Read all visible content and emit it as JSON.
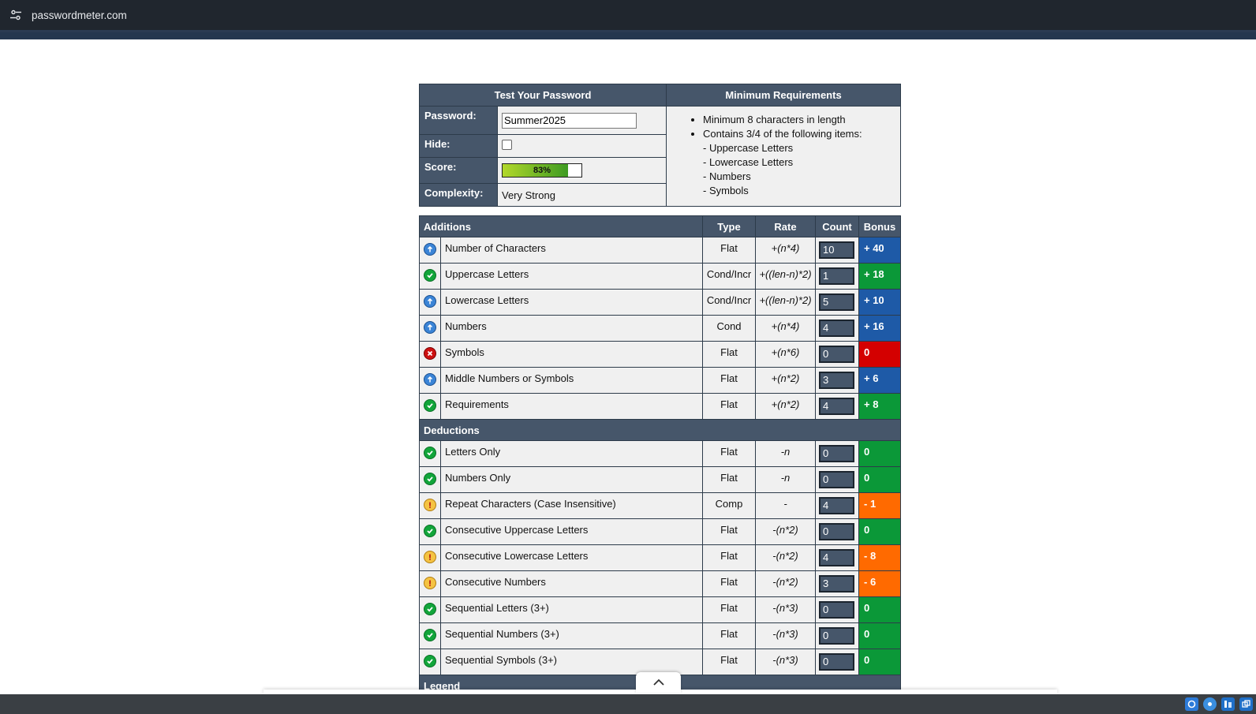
{
  "browser": {
    "url": "passwordmeter.com"
  },
  "test_section": {
    "header": "Test Your Password",
    "password_label": "Password:",
    "password_value": "Summer2025",
    "hide_label": "Hide:",
    "score_label": "Score:",
    "score_text": "83%",
    "score_percent": 83,
    "complexity_label": "Complexity:",
    "complexity_value": "Very Strong"
  },
  "requirements": {
    "header": "Minimum Requirements",
    "items": [
      "Minimum 8 characters in length",
      "Contains 3/4 of the following items:"
    ],
    "sub_items": [
      "- Uppercase Letters",
      "- Lowercase Letters",
      "- Numbers",
      "- Symbols"
    ]
  },
  "score_table": {
    "headers": {
      "additions": "Additions",
      "type": "Type",
      "rate": "Rate",
      "count": "Count",
      "bonus": "Bonus"
    },
    "deductions_label": "Deductions",
    "legend_label": "Legend",
    "additions": [
      {
        "status": "exceptional",
        "desc": "Number of Characters",
        "type": "Flat",
        "rate": "+(n*4)",
        "count": "10",
        "bonus": "+ 40",
        "color": "blue"
      },
      {
        "status": "sufficient",
        "desc": "Uppercase Letters",
        "type": "Cond/Incr",
        "rate": "+((len-n)*2)",
        "count": "1",
        "bonus": "+ 18",
        "color": "green"
      },
      {
        "status": "exceptional",
        "desc": "Lowercase Letters",
        "type": "Cond/Incr",
        "rate": "+((len-n)*2)",
        "count": "5",
        "bonus": "+ 10",
        "color": "blue"
      },
      {
        "status": "exceptional",
        "desc": "Numbers",
        "type": "Cond",
        "rate": "+(n*4)",
        "count": "4",
        "bonus": "+ 16",
        "color": "blue"
      },
      {
        "status": "failure",
        "desc": "Symbols",
        "type": "Flat",
        "rate": "+(n*6)",
        "count": "0",
        "bonus": "0",
        "color": "red"
      },
      {
        "status": "exceptional",
        "desc": "Middle Numbers or Symbols",
        "type": "Flat",
        "rate": "+(n*2)",
        "count": "3",
        "bonus": "+ 6",
        "color": "blue"
      },
      {
        "status": "sufficient",
        "desc": "Requirements",
        "type": "Flat",
        "rate": "+(n*2)",
        "count": "4",
        "bonus": "+ 8",
        "color": "green"
      }
    ],
    "deductions": [
      {
        "status": "sufficient",
        "desc": "Letters Only",
        "type": "Flat",
        "rate": "-n",
        "count": "0",
        "bonus": "0",
        "color": "green"
      },
      {
        "status": "sufficient",
        "desc": "Numbers Only",
        "type": "Flat",
        "rate": "-n",
        "count": "0",
        "bonus": "0",
        "color": "green"
      },
      {
        "status": "warning",
        "desc": "Repeat Characters (Case Insensitive)",
        "type": "Comp",
        "rate": "-",
        "count": "4",
        "bonus": "- 1",
        "color": "orange"
      },
      {
        "status": "sufficient",
        "desc": "Consecutive Uppercase Letters",
        "type": "Flat",
        "rate": "-(n*2)",
        "count": "0",
        "bonus": "0",
        "color": "green"
      },
      {
        "status": "warning",
        "desc": "Consecutive Lowercase Letters",
        "type": "Flat",
        "rate": "-(n*2)",
        "count": "4",
        "bonus": "- 8",
        "color": "orange"
      },
      {
        "status": "warning",
        "desc": "Consecutive Numbers",
        "type": "Flat",
        "rate": "-(n*2)",
        "count": "3",
        "bonus": "- 6",
        "color": "orange"
      },
      {
        "status": "sufficient",
        "desc": "Sequential Letters (3+)",
        "type": "Flat",
        "rate": "-(n*3)",
        "count": "0",
        "bonus": "0",
        "color": "green"
      },
      {
        "status": "sufficient",
        "desc": "Sequential Numbers (3+)",
        "type": "Flat",
        "rate": "-(n*3)",
        "count": "0",
        "bonus": "0",
        "color": "green"
      },
      {
        "status": "sufficient",
        "desc": "Sequential Symbols (3+)",
        "type": "Flat",
        "rate": "-(n*3)",
        "count": "0",
        "bonus": "0",
        "color": "green"
      }
    ]
  },
  "colors": {
    "header_bg": "#46566a",
    "cell_bg": "#f0f0f0",
    "blue": "#1e5aa7",
    "green": "#0b9838",
    "red": "#d40000",
    "orange": "#ff6a00"
  },
  "icons": {
    "site_info": "tune-icon",
    "scroll_top": "chevron-up-icon",
    "status_exceptional": "exceptional-icon",
    "status_sufficient": "check-icon",
    "status_failure": "x-icon",
    "status_warning": "warning-icon"
  }
}
